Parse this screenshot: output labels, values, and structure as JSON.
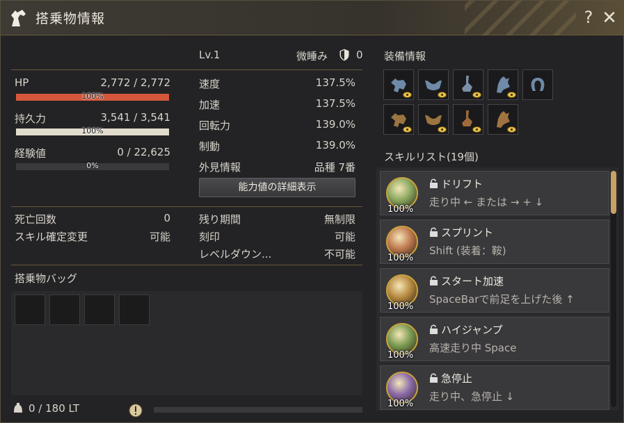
{
  "window": {
    "title": "搭乗物情報",
    "help_label": "?",
    "close_label": "✕"
  },
  "level": "Lv.1",
  "condition": {
    "label": "微睡み",
    "shield_value": "0"
  },
  "stats_left": {
    "hp": {
      "label": "HP",
      "value": "2,772 / 2,772",
      "percent_label": "100%",
      "fill": 1.0,
      "color": "#d4573c"
    },
    "durability": {
      "label": "持久力",
      "value": "3,541 / 3,541",
      "percent_label": "100%",
      "fill": 1.0,
      "color": "#e2dccd"
    },
    "exp": {
      "label": "経験値",
      "value": "0 / 22,625",
      "percent_label": "0%",
      "fill": 0.0,
      "color": "#8a8a8a"
    }
  },
  "stats_right": [
    {
      "label": "速度",
      "value": "137.5%"
    },
    {
      "label": "加速",
      "value": "137.5%"
    },
    {
      "label": "回転力",
      "value": "139.0%"
    },
    {
      "label": "制動",
      "value": "139.0%"
    },
    {
      "label": "外見情報",
      "value": "品種 7番"
    }
  ],
  "details_button": "能力値の詳細表示",
  "info_left": [
    {
      "label": "死亡回数",
      "value": "0"
    },
    {
      "label": "スキル確定変更",
      "value": "可能"
    }
  ],
  "info_right": [
    {
      "label": "残り期間",
      "value": "無制限"
    },
    {
      "label": "刻印",
      "value": "可能"
    },
    {
      "label": "レベルダウン...",
      "value": "不可能"
    }
  ],
  "bag": {
    "title": "搭乗物バッグ",
    "slots": 4
  },
  "footer": {
    "weight": "0 / 180 LT",
    "warning_icon": "alert-icon"
  },
  "equipment": {
    "title": "装備情報",
    "row1": [
      "barding-icon",
      "saddle-icon",
      "stirrups-icon",
      "champron-icon",
      "horseshoe-icon"
    ],
    "row2": [
      "barding-icon",
      "saddle-icon",
      "stirrups-icon",
      "champron-icon"
    ]
  },
  "skills": {
    "title": "スキルリスト(19個)",
    "items": [
      {
        "name": "ドリフト",
        "desc": "走り中 ← または → + ↓",
        "percent": "100%",
        "color": "#8aa860"
      },
      {
        "name": "スプリント",
        "desc": "Shift (装着：鞍)",
        "percent": "100%",
        "color": "#c07a50"
      },
      {
        "name": "スタート加速",
        "desc": "SpaceBarで前足を上げた後 ↑",
        "percent": "100%",
        "color": "#b88a40"
      },
      {
        "name": "ハイジャンプ",
        "desc": "高速走り中 Space",
        "percent": "100%",
        "color": "#7a9a50"
      },
      {
        "name": "急停止",
        "desc": "走り中、急停止 ↓",
        "percent": "100%",
        "color": "#8a6aa8"
      }
    ]
  }
}
